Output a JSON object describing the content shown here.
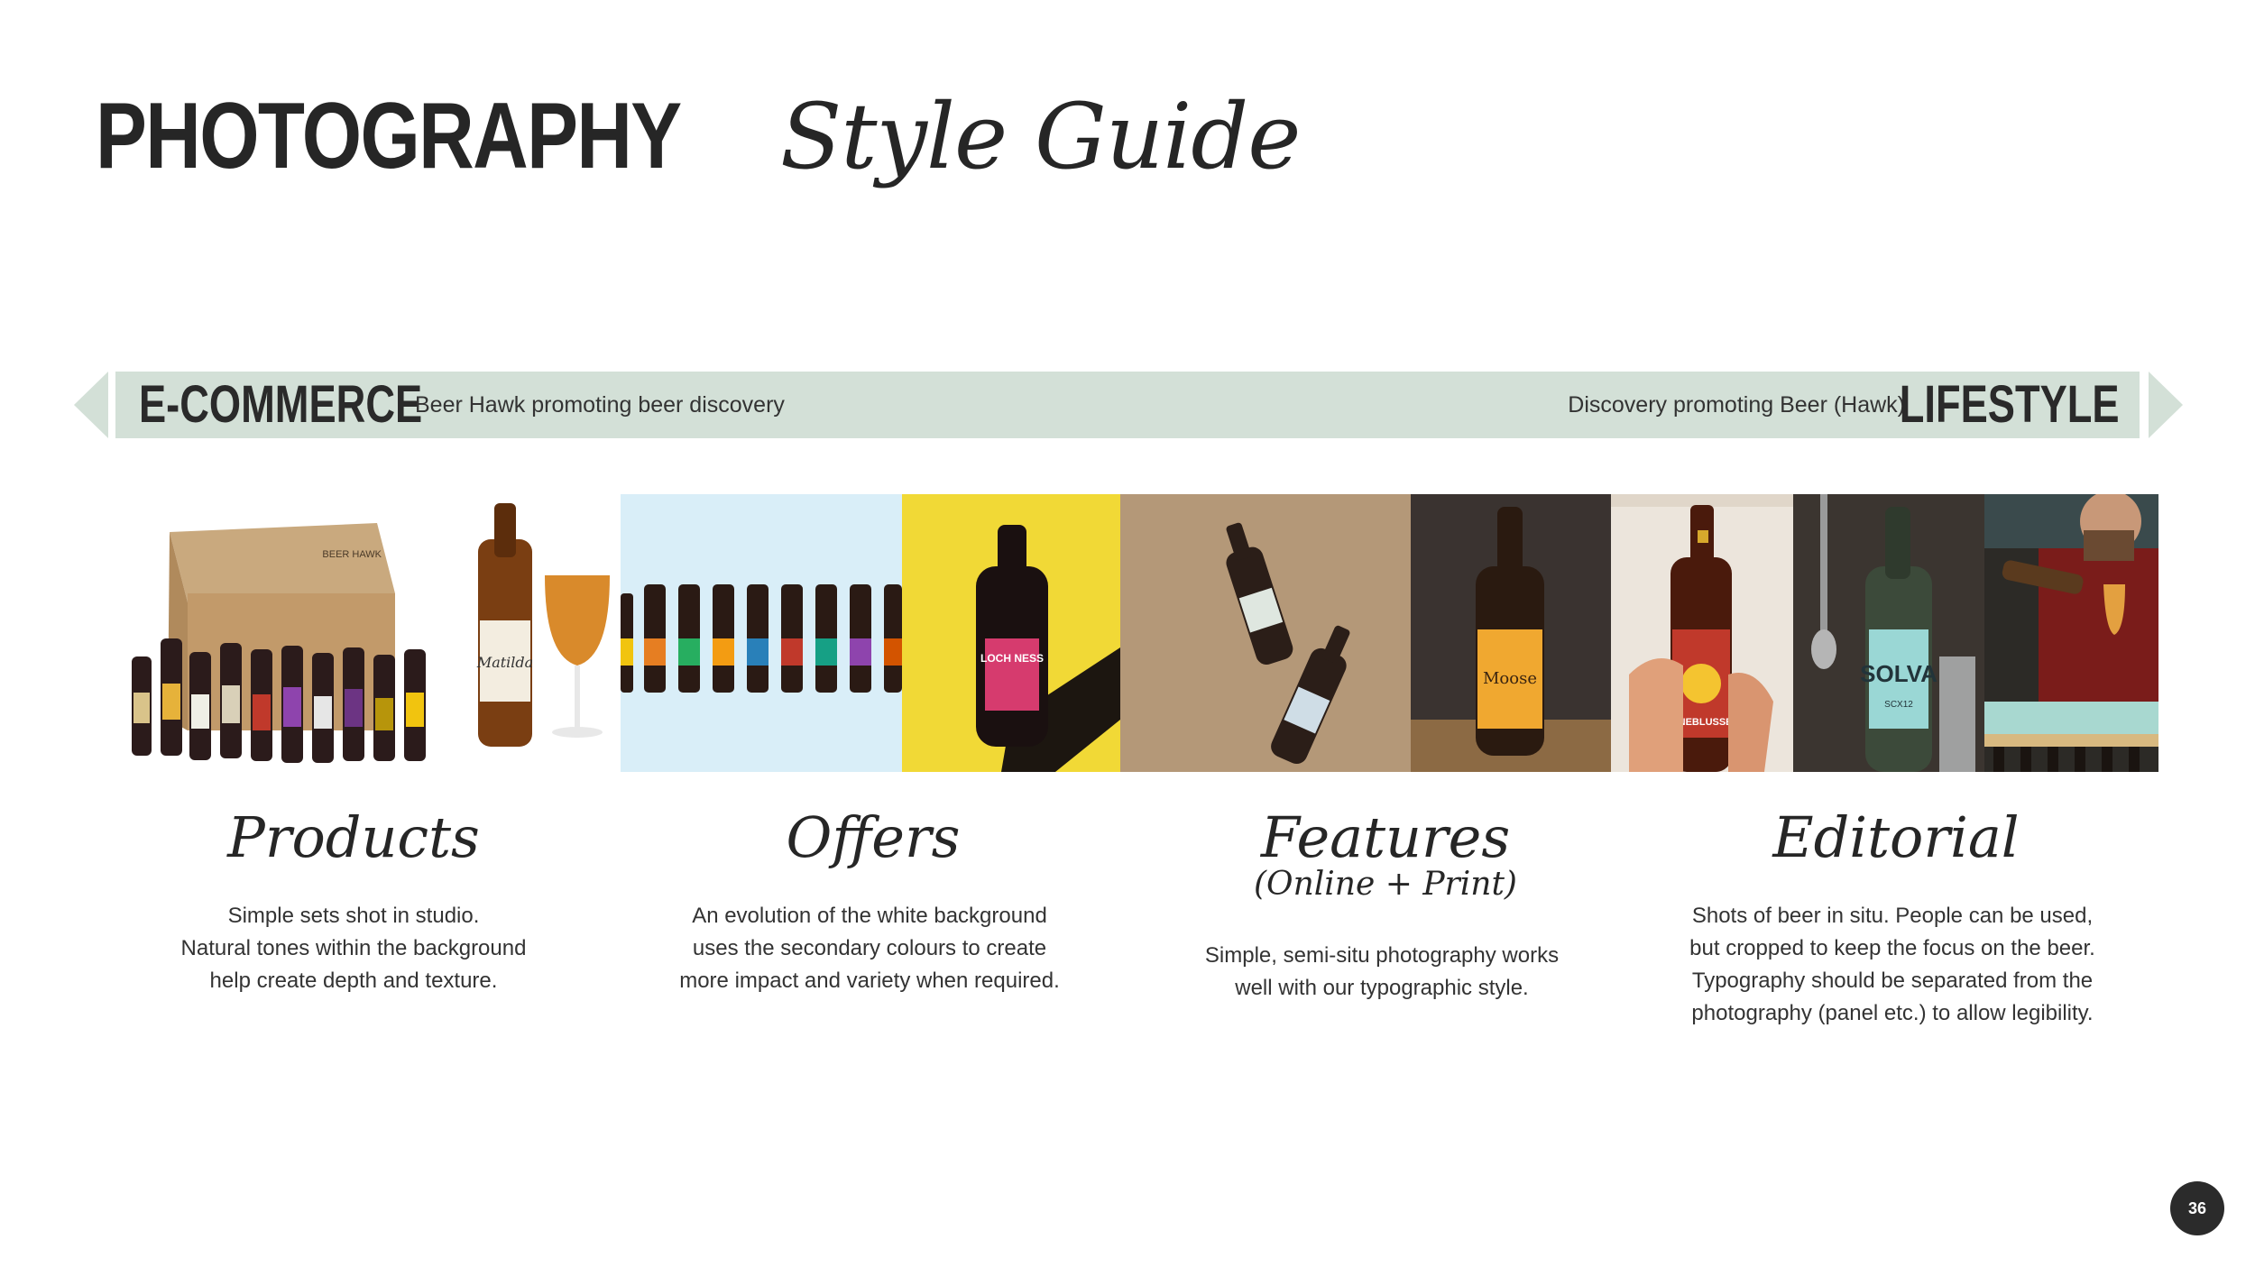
{
  "header": {
    "title_bold": "PHOTOGRAPHY",
    "title_italic": "Style Guide"
  },
  "spectrum": {
    "left_label": "E-COMMERCE",
    "left_desc": "Beer Hawk promoting beer discovery",
    "right_desc": "Discovery promoting Beer (Hawk)",
    "right_label": "LIFESTYLE",
    "color": "#d3e0d7"
  },
  "photos": {
    "box_brand": "BEER HAWK",
    "bottle_label": "Matilda",
    "loch_ness_label": "LOCH NESS",
    "moose_label": "Moose",
    "maneblusser_label": "MANEBLUSSER",
    "solva_label": "SOLVA",
    "solva_sub": "SCX12"
  },
  "categories": [
    {
      "title": "Products",
      "subtitle": "",
      "lines": [
        "Simple sets shot in studio.",
        "Natural tones within the background",
        "help create depth and texture."
      ]
    },
    {
      "title": "Offers",
      "subtitle": "",
      "lines": [
        "An evolution of the white background",
        "uses the secondary colours to create",
        "more impact and variety when required."
      ]
    },
    {
      "title": "Features",
      "subtitle": "(Online + Print)",
      "lines": [
        "Simple, semi-situ photography works",
        "well with our typographic style."
      ]
    },
    {
      "title": "Editorial",
      "subtitle": "",
      "lines": [
        "Shots of beer in situ. People can be used,",
        "but cropped to keep the focus on the beer.",
        "Typography should be separated from the",
        "photography (panel etc.) to allow legibility."
      ]
    }
  ],
  "page": {
    "number": "36"
  }
}
